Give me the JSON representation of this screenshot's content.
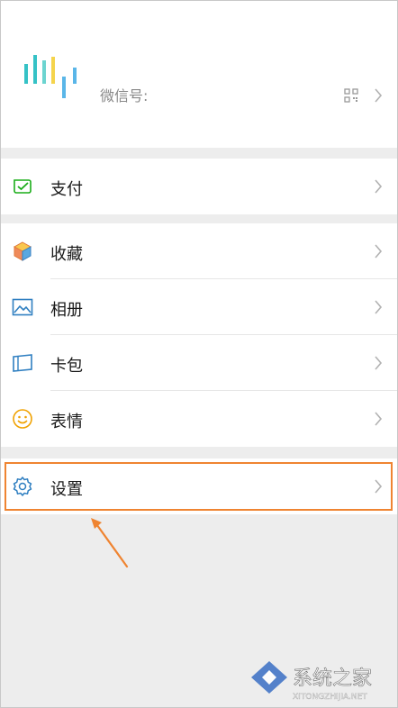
{
  "profile": {
    "wechat_id_label": "微信号:",
    "qr_icon": "qr-code-icon"
  },
  "menu": {
    "pay": {
      "label": "支付",
      "icon": "wallet-check-icon"
    },
    "favorites": {
      "label": "收藏",
      "icon": "cube-icon"
    },
    "album": {
      "label": "相册",
      "icon": "photo-icon"
    },
    "cards": {
      "label": "卡包",
      "icon": "card-icon"
    },
    "stickers": {
      "label": "表情",
      "icon": "smiley-icon"
    },
    "settings": {
      "label": "设置",
      "icon": "gear-icon"
    }
  },
  "watermark": {
    "text_cn": "系统之家",
    "text_en": "XITONGZHIJIA.NET"
  },
  "colors": {
    "background": "#ededed",
    "highlight": "#ef8431",
    "pay_green": "#1aad19",
    "icon_blue": "#2f7fc1"
  }
}
